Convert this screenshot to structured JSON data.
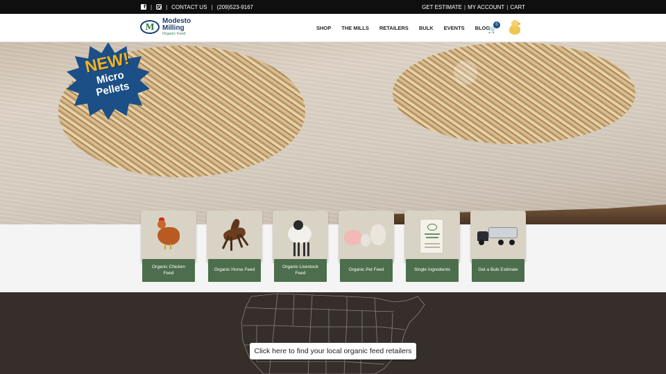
{
  "topbar": {
    "facebook_icon": "facebook-icon",
    "instagram_icon": "instagram-icon",
    "separator": "|",
    "contact_label": "CONTACT US",
    "phone": "(209)523-9167",
    "get_estimate": "GET ESTIMATE",
    "my_account": "MY ACCOUNT",
    "cart": "CART"
  },
  "header": {
    "logo_name_1": "Modesto",
    "logo_name_2": "Milling",
    "logo_tagline": "Organic Feed",
    "logo_mark": "M",
    "nav": [
      "SHOP",
      "THE MILLS",
      "RETAILERS",
      "BULK",
      "EVENTS",
      "BLOG"
    ],
    "cart_icon": "shopping-cart-icon",
    "cart_count": "0",
    "chick_icon": "chick-icon"
  },
  "hero": {
    "badge_new": "NEW!",
    "badge_line1": "Micro",
    "badge_line2": "Pellets"
  },
  "categories": [
    {
      "label": "Organic Chicken Feed",
      "image": "chicken"
    },
    {
      "label": "Organic Horse Feed",
      "image": "horse"
    },
    {
      "label": "Organic Livestock Feed",
      "image": "sheep"
    },
    {
      "label": "Organic Pet Feed",
      "image": "pets"
    },
    {
      "label": "Single Ingredients",
      "image": "feed-bag"
    },
    {
      "label": "Get a Bulk Estimate",
      "image": "truck"
    }
  ],
  "map": {
    "retailer_button": "Click here to find your local organic feed retailers"
  },
  "colors": {
    "topbar": "#0f0f0f",
    "brand_navy": "#1c3f68",
    "brand_green": "#4c6e4c",
    "map_bg": "#352e2a"
  }
}
